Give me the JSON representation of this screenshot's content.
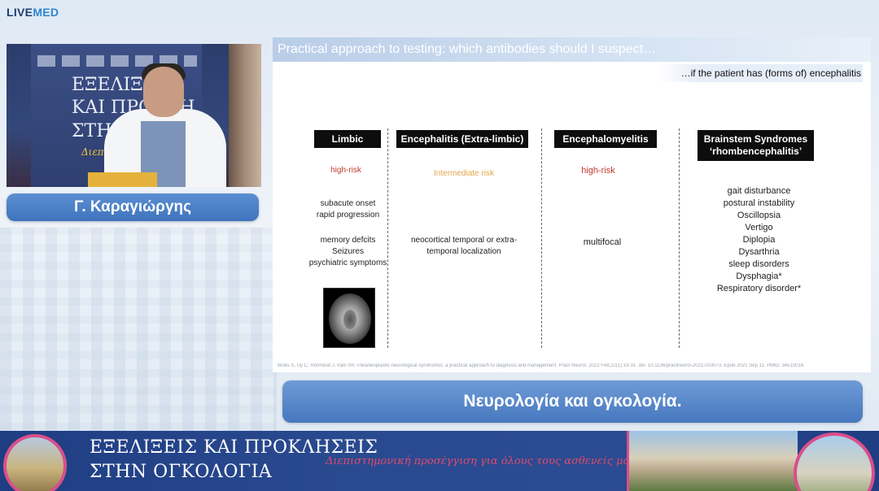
{
  "brand": {
    "live": "LIVE",
    "med": "MED"
  },
  "video": {
    "banner_line1": "ΕΞΕΛΙΞΕ",
    "banner_line2": "ΚΑΙ ΠΡΟΚΛΗ",
    "banner_line3": "ΣΤΗΝ ΟΓΚ",
    "banner_line4": "Διεπιστημο"
  },
  "speaker": {
    "name": "Γ. Καραγιώργης"
  },
  "slide": {
    "title": "Practical approach to testing: which antibodies should I suspect…",
    "subtitle": "…if the patient has (forms of) encephalitis",
    "columns": [
      {
        "title": "Limbic",
        "risk": "high-risk",
        "onset": [
          "subacute onset",
          "rapid progression"
        ],
        "features": [
          "memory defcits",
          "Seizures",
          "psychiatric symptoms"
        ]
      },
      {
        "title": "Encephalitis (Extra-limbic)",
        "risk": "Intermediate risk",
        "features": [
          "neocortical temporal or extra-",
          "temporal localization"
        ]
      },
      {
        "title": "Encephalomyelitis",
        "risk": "high-risk",
        "features": [
          "multifocal"
        ]
      },
      {
        "title_line1": "Brainstem Syndromes",
        "title_line2": "‘rhombencephalitis’",
        "features": [
          "gait disturbance",
          "postural instability",
          "Oscillopsia",
          "Vertigo",
          "Diplopia",
          "Dysarthria",
          "sleep disorders"
        ],
        "bold_features": [
          "Dysphagia*",
          "Respiratory disorder*"
        ]
      }
    ],
    "citation": "Binks S, Uy C, Honnorat J, Irani SR. Paraneoplastic neurological syndromes: a practical approach to diagnosis and management. Pract Neurol. 2022 Feb;22(1):19-31. doi: 10.1136/practneurol-2021-003073. Epub 2021 Sep 11. PMID: 34510016."
  },
  "topic": "Νευρολογία και ογκολογία.",
  "footer": {
    "title_line1": "ΕΞΕΛΙΞΕΙΣ ΚΑΙ ΠΡΟΚΛΗΣΕΙΣ",
    "title_line2": "ΣΤΗΝ ΟΓΚΟΛΟΓΙΑ",
    "tagline": "Διεπιστημονική προσέγγιση για όλους τους ασθενείς μας"
  },
  "colors": {
    "brand_dark": "#1d3f73",
    "brand_light": "#2e86d1",
    "accent_pink": "#d94f8a",
    "risk_high": "#c0392b",
    "risk_mid": "#e0a64a"
  }
}
